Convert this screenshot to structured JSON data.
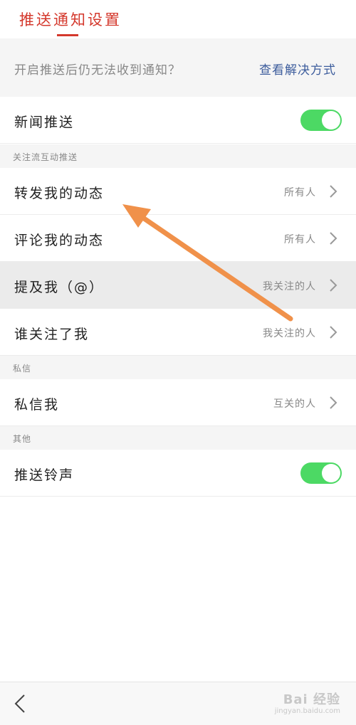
{
  "header": {
    "title": "推送通知设置"
  },
  "notice": {
    "text": "开启推送后仍无法收到通知？",
    "link": "查看解决方式"
  },
  "news_push": {
    "label": "新闻推送",
    "toggle_on": true
  },
  "section_follow": {
    "title": "关注流互动推送",
    "items": [
      {
        "label": "转发我的动态",
        "value": "所有人"
      },
      {
        "label": "评论我的动态",
        "value": "所有人"
      },
      {
        "label": "提及我（@）",
        "value": "我关注的人"
      },
      {
        "label": "谁关注了我",
        "value": "我关注的人"
      }
    ]
  },
  "section_dm": {
    "title": "私信",
    "items": [
      {
        "label": "私信我",
        "value": "互关的人"
      }
    ]
  },
  "section_other": {
    "title": "其他",
    "ringtone": {
      "label": "推送铃声",
      "toggle_on": true
    }
  },
  "bottom": {
    "back_icon": "chevron-left-icon",
    "watermark_logo": "Bai 经验",
    "watermark_url": "jingyan.baidu.com"
  },
  "colors": {
    "accent_red": "#d4382c",
    "link_blue": "#3c5c9c",
    "toggle_green": "#4cd964",
    "annotation_arrow": "#f0914a"
  }
}
